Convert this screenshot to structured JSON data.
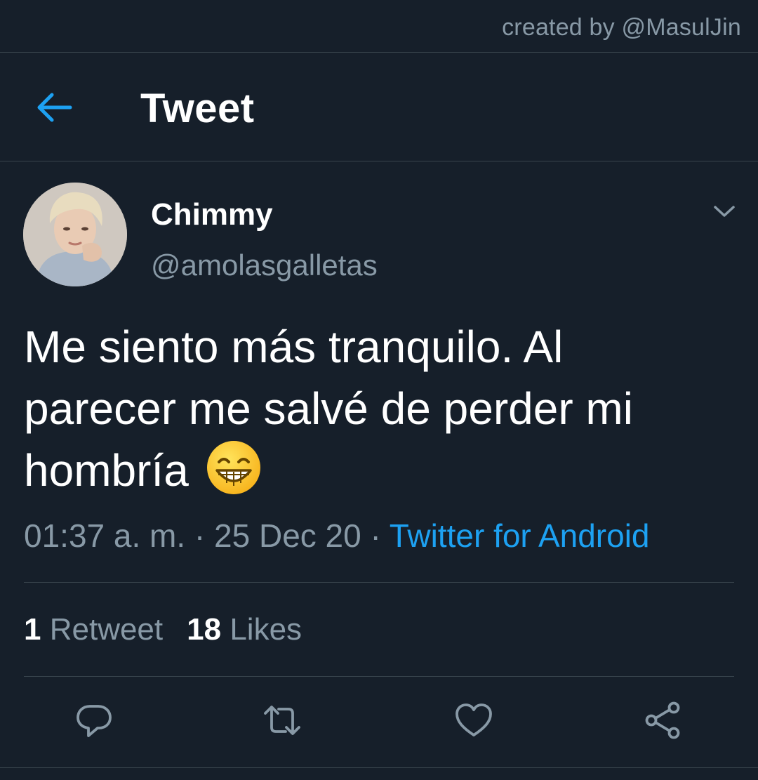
{
  "credit": "created by @MasulJin",
  "header": {
    "title": "Tweet",
    "back_icon": "arrow-left-icon"
  },
  "tweet": {
    "author": {
      "display_name": "Chimmy",
      "handle": "@amolasgalletas",
      "avatar": "user-avatar-photo"
    },
    "text_lines": [
      "Me siento más tranquilo. Al",
      "parecer me salvé de perder mi",
      "hombría"
    ],
    "emoji": "grinning-face-with-smiling-eyes",
    "time": "01:37 a. m.",
    "separator": "·",
    "date": "25 Dec 20",
    "source": "Twitter for Android",
    "stats": {
      "retweets_count": "1",
      "retweets_label": "Retweet",
      "likes_count": "18",
      "likes_label": "Likes"
    }
  },
  "actions": [
    {
      "icon": "reply-icon"
    },
    {
      "icon": "retweet-icon"
    },
    {
      "icon": "like-heart-icon"
    },
    {
      "icon": "share-icon"
    }
  ],
  "colors": {
    "background": "#161f2a",
    "accent": "#1da1f2",
    "muted": "#8899a6",
    "divider": "#38444d",
    "text": "#ffffff"
  }
}
